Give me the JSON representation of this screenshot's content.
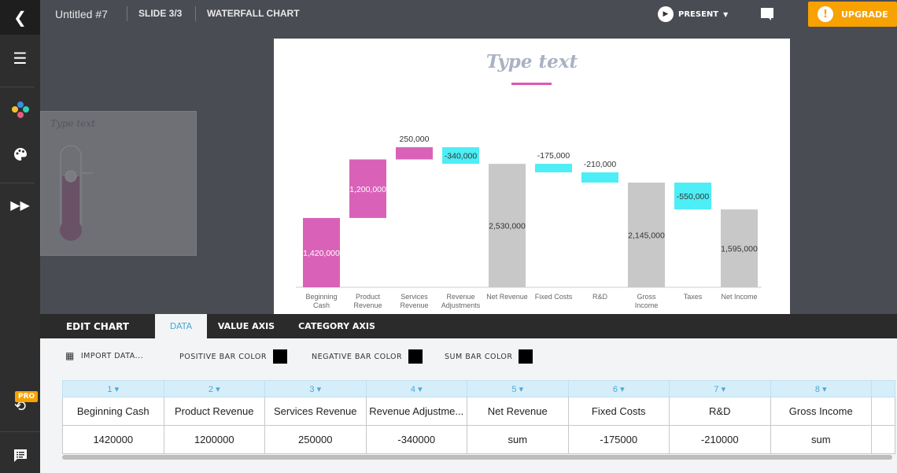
{
  "topbar": {
    "title": "Untitled #7",
    "slide": "SLIDE 3/3",
    "chart_name": "WATERFALL CHART",
    "present": "PRESENT",
    "upgrade": "UPGRADE"
  },
  "sidebar": {
    "pro_badge": "PRO",
    "icons": [
      "menu-icon",
      "apps-icon",
      "palette-icon",
      "fast-forward-icon",
      "history-icon",
      "feedback-icon"
    ]
  },
  "thumbnail": {
    "title": "Type text"
  },
  "slide": {
    "title": "Type text"
  },
  "colors": {
    "positive": "#d962b8",
    "negative": "#4deef5",
    "sum": "#c8c8c8",
    "accent": "#f7a200",
    "title_line": "#e055b4"
  },
  "chart_data": {
    "type": "waterfall",
    "categories": [
      "Beginning Cash",
      "Product Revenue",
      "Services Revenue",
      "Revenue Adjustments",
      "Net Revenue",
      "Fixed Costs",
      "R&D",
      "Gross Income",
      "Taxes",
      "Net Income"
    ],
    "values": [
      1420000,
      1200000,
      250000,
      -340000,
      2530000,
      -175000,
      -210000,
      2145000,
      -550000,
      1595000
    ],
    "kinds": [
      "positive",
      "positive",
      "positive",
      "negative",
      "sum",
      "negative",
      "negative",
      "sum",
      "negative",
      "sum"
    ],
    "labels": [
      "1,420,000",
      "1,200,000",
      "250,000",
      "-340,000",
      "2,530,000",
      "-175,000",
      "-210,000",
      "2,145,000",
      "-550,000",
      "1,595,000"
    ],
    "ylim": [
      0,
      2700000
    ],
    "grid": false
  },
  "panel": {
    "tabs": [
      {
        "label": "EDIT CHART"
      },
      {
        "label": "DATA"
      },
      {
        "label": "VALUE AXIS"
      },
      {
        "label": "CATEGORY AXIS"
      }
    ],
    "import": "IMPORT DATA...",
    "positive_color": "POSITIVE BAR COLOR",
    "negative_color": "NEGATIVE BAR COLOR",
    "sum_color": "SUM BAR COLOR",
    "table": {
      "columns": [
        "1",
        "2",
        "3",
        "4",
        "5",
        "6",
        "7",
        "8",
        ""
      ],
      "names": [
        "Beginning Cash",
        "Product Revenue",
        "Services Revenue",
        "Revenue Adjustme...",
        "Net Revenue",
        "Fixed Costs",
        "R&D",
        "Gross Income",
        ""
      ],
      "values": [
        "1420000",
        "1200000",
        "250000",
        "-340000",
        "sum",
        "-175000",
        "-210000",
        "sum",
        ""
      ]
    }
  }
}
